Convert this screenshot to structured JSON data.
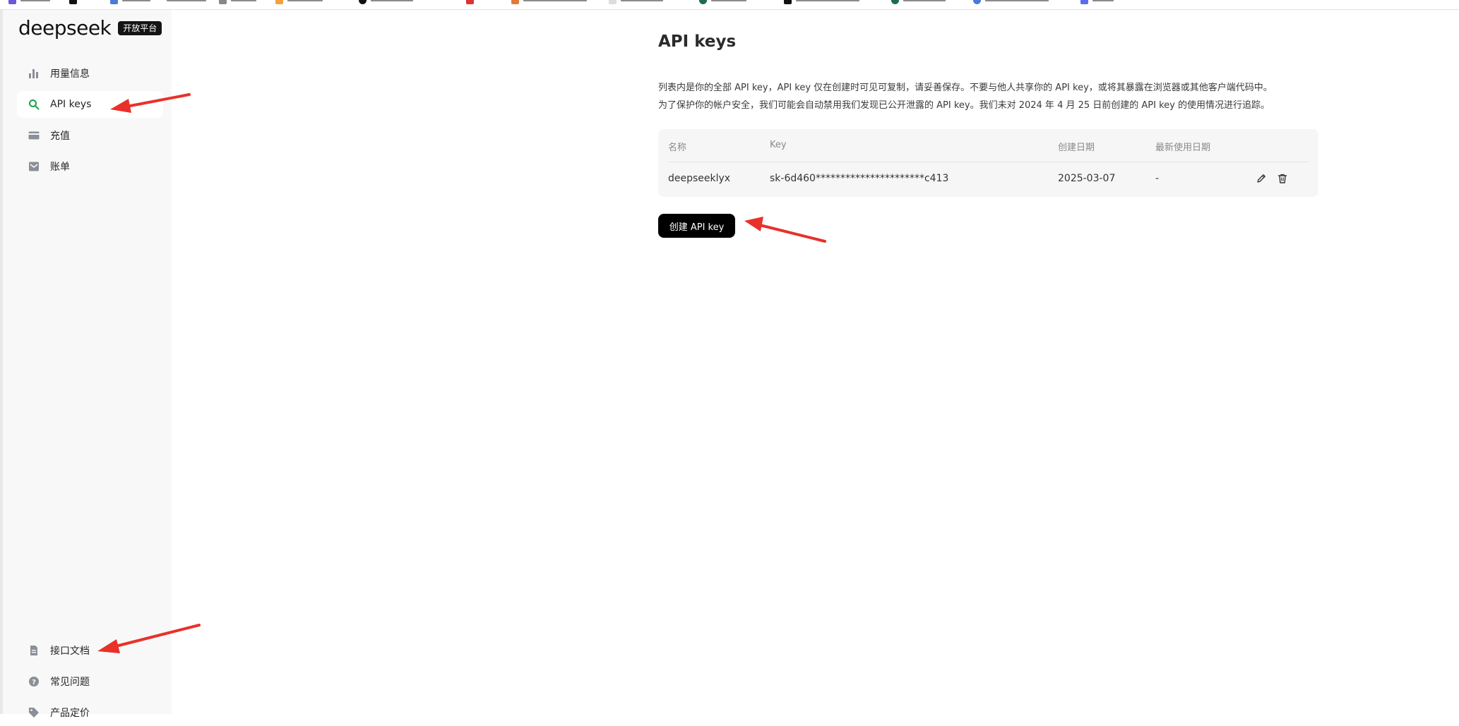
{
  "sidebar": {
    "logo_text": "deepseek",
    "logo_badge": "开放平台",
    "items": [
      {
        "label": "用量信息",
        "icon": "bar-chart-icon",
        "active": false
      },
      {
        "label": "API keys",
        "icon": "search-icon",
        "active": true
      },
      {
        "label": "充值",
        "icon": "card-icon",
        "active": false
      },
      {
        "label": "账单",
        "icon": "bill-icon",
        "active": false
      }
    ],
    "bottom_items": [
      {
        "label": "接口文档",
        "icon": "document-icon"
      },
      {
        "label": "常见问题",
        "icon": "question-icon"
      },
      {
        "label": "产品定价",
        "icon": "tag-icon"
      }
    ]
  },
  "main": {
    "title": "API keys",
    "description_line1": "列表内是你的全部 API key，API key 仅在创建时可见可复制，请妥善保存。不要与他人共享你的 API key，或将其暴露在浏览器或其他客户端代码中。",
    "description_line2": "为了保护你的帐户安全，我们可能会自动禁用我们发现已公开泄露的 API key。我们未对 2024 年 4 月 25 日前创建的 API key 的使用情况进行追踪。",
    "table": {
      "headers": [
        "名称",
        "Key",
        "创建日期",
        "最新使用日期"
      ],
      "rows": [
        {
          "name": "deepseeklyx",
          "key": "sk-6d460**********************c413",
          "created": "2025-03-07",
          "last_used": "-"
        }
      ]
    },
    "create_button": "创建 API key"
  },
  "annotation_color": "#e8312a"
}
